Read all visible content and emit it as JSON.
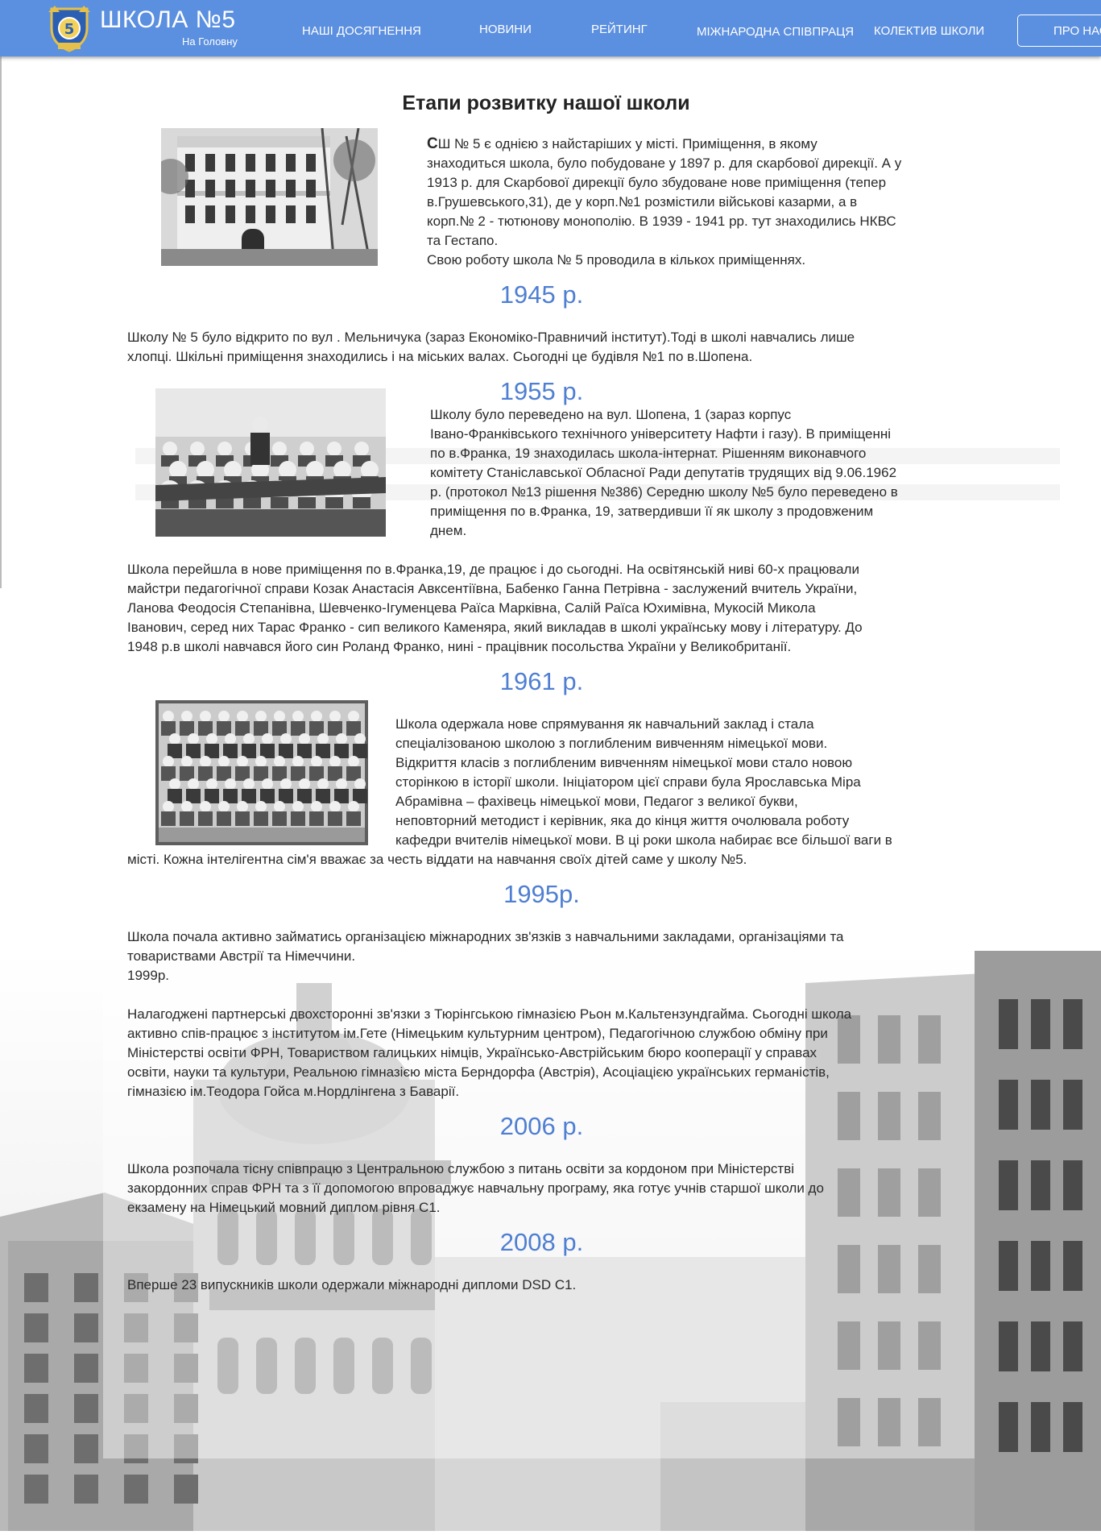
{
  "header": {
    "brand_name": "ШКОЛА №5",
    "brand_home": "На Головну",
    "nav": [
      "НАШІ ДОСЯГНЕННЯ",
      "НОВИНИ",
      "РЕЙТИНГ",
      "МІЖНАРОДНА СПІВПРАЦЯ",
      "КОЛЕКТИВ ШКОЛИ"
    ],
    "cta": "ПРО НАС"
  },
  "page": {
    "title": "Етапи розвитку нашої школи",
    "intro": {
      "first_letter": "С",
      "lines": [
        "Ш № 5 є однією з найстаріших у місті. Приміщення, в якому",
        "знаходиться школа, було побудоване у 1897 р. для скарбової дирекції. А у",
        "1913 р. для Скарбової дирекції було збудоване нове приміщення (тепер",
        "в.Грушевського,31), де у корп.№1 розмістили військові казарми, а в",
        "корп.№ 2 - тютюнову монополію. В 1939 - 1941 рр. тут знаходились НКВС",
        "та Гестапо.",
        "Свою роботу школа № 5 проводила в кількох приміщеннях."
      ]
    },
    "sections": [
      {
        "year": "1945 р.",
        "lines": [
          "Школу № 5 було відкрито по вул . Мельничука (зараз Економіко-Правничий інститут).Тоді в школі навчались лише",
          "хлопці. Шкільні приміщення знаходились і на міських валах. Сьогодні це будівля №1 по в.Шопена."
        ]
      },
      {
        "year": "1955 р.",
        "lines": [
          "Школу було переведено на вул.     Шопена, 1 (зараз корпус",
          "Івано-Франківського технічного університету Нафти і газу). В приміщенні",
          "по в.Франка, 19 знаходилась школа-інтернат. Рішенням виконавчого",
          "комітету Станіславської Обласної Ради депутатів трудящих від 9.06.1962",
          "р. (протокол №13 рішення №386) Середню школу №5 було переведено в",
          "приміщення по в.Франка, 19, затвердивши її як школу з продовженим",
          "днем."
        ],
        "extra_lines": [
          "Школа перейшла в нове приміщення по в.Франка,19, де працює і до сьогодні. На освітянській ниві 60-х працювали",
          "майстри педагогічної справи Козак Анастасія Авксентіївна, Бабенко Ганна Петрівна - заслужений вчитель України,",
          "Ланова Феодосія Степанівна, Шевченко-Ігуменцева Раїса Марківна, Салій Раїса Юхимівна, Мукосій Микола",
          "Іванович, серед них Тарас Франко - сип великого Каменяра, який викладав в школі українську мову і літературу. До",
          "1948 р.в школі навчався його син Роланд Франко, нині - працівник посольства України у Великобританії."
        ]
      },
      {
        "year": "1961 р.",
        "lines": [
          "Школа одержала нове спрямування як навчальний заклад і стала",
          "спеціалізованою школою з поглибленим вивченням німецької мови.",
          "Відкриття класів з поглибленим вивченням німецької мови стало новою",
          "сторінкою в історії школи. Ініціатором цієї справи була Ярославська Міра",
          "Абрамівна – фахівець німецької мови, Педагог з великої букви,",
          "неповторний методист і керівник, яка до кінця життя очолювала роботу",
          "кафедри вчителів німецької мови. В ці роки школа набирає все більшої ваги в",
          "місті. Кожна інтелігентна сім'я вважає за честь віддати на навчання своїх дітей саме у школу №5."
        ]
      },
      {
        "year": "1995р.",
        "lines": [
          "Школа почала активно займатись організацією міжнародних зв'язків з навчальними закладами, організаціями та",
          "товариствами Австрії та Німеччини.",
          "1999р.",
          "",
          "Налагоджені партнерські двохсторонні зв'язки з Тюрінгською гімназією Рьон м.Кальтензундгайма. Сьогодні школа",
          "активно спів-працює з інститутом ім.Гете (Німецьким культурним центром), Педагогічною службою обміну при",
          "Міністерстві освіти ФРН, Товариством галицьких німців, Українсько-Австрійським бюро кооперації у справах",
          "освіти, науки та культури, Реальною гімназією міста Берндорфа (Австрія), Асоціацією українських германістів,",
          "гімназією ім.Теодора Гойса м.Нордлінгена з Баварії."
        ]
      },
      {
        "year": "2006 р.",
        "lines": [
          "Школа розпочала тісну співпрацю з Центральною службою з питань освіти за кордоном при Міністерстві",
          "закордонних справ ФРН та з її допомогою впроваджує навчальну програму, яка готує учнів старшої школи до",
          "екзамену на Німецький мовний диплом рівня С1."
        ]
      },
      {
        "year": "2008 р.",
        "lines": [
          "Вперше 23 випускників школи одержали міжнародні дипломи DSD C1."
        ]
      }
    ]
  },
  "theme": {
    "header_bg": "#5b8fdf",
    "year_color": "#4f7fd2",
    "text_color": "#2a2a2a"
  },
  "icons": {
    "logo": "school-crest-icon"
  }
}
